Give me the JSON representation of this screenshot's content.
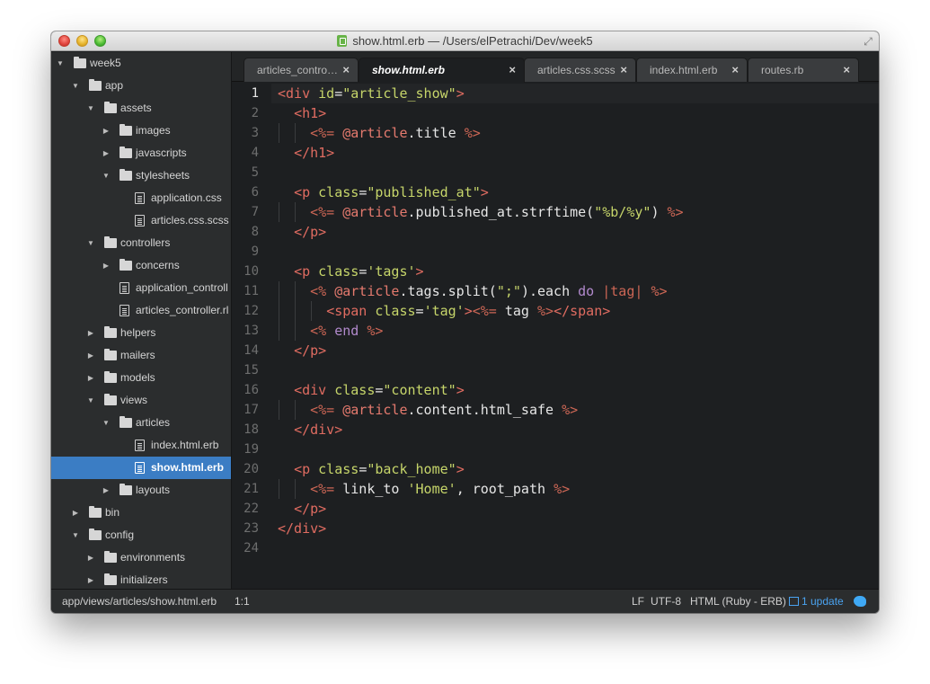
{
  "window": {
    "title": "show.html.erb — /Users/elPetrachi/Dev/week5"
  },
  "sidebar": {
    "items": [
      {
        "label": "week5",
        "type": "folder",
        "depth": 0,
        "expanded": true
      },
      {
        "label": "app",
        "type": "folder",
        "depth": 1,
        "expanded": true
      },
      {
        "label": "assets",
        "type": "folder",
        "depth": 2,
        "expanded": true
      },
      {
        "label": "images",
        "type": "folder",
        "depth": 3,
        "expanded": false
      },
      {
        "label": "javascripts",
        "type": "folder",
        "depth": 3,
        "expanded": false
      },
      {
        "label": "stylesheets",
        "type": "folder",
        "depth": 3,
        "expanded": true
      },
      {
        "label": "application.css",
        "type": "file",
        "depth": 4
      },
      {
        "label": "articles.css.scss",
        "type": "file",
        "depth": 4
      },
      {
        "label": "controllers",
        "type": "folder",
        "depth": 2,
        "expanded": true
      },
      {
        "label": "concerns",
        "type": "folder",
        "depth": 3,
        "expanded": false
      },
      {
        "label": "application_controll",
        "type": "file",
        "depth": 3
      },
      {
        "label": "articles_controller.rl",
        "type": "file",
        "depth": 3
      },
      {
        "label": "helpers",
        "type": "folder",
        "depth": 2,
        "expanded": false
      },
      {
        "label": "mailers",
        "type": "folder",
        "depth": 2,
        "expanded": false
      },
      {
        "label": "models",
        "type": "folder",
        "depth": 2,
        "expanded": false
      },
      {
        "label": "views",
        "type": "folder",
        "depth": 2,
        "expanded": true
      },
      {
        "label": "articles",
        "type": "folder",
        "depth": 3,
        "expanded": true
      },
      {
        "label": "index.html.erb",
        "type": "file",
        "depth": 4
      },
      {
        "label": "show.html.erb",
        "type": "file",
        "depth": 4,
        "selected": true
      },
      {
        "label": "layouts",
        "type": "folder",
        "depth": 3,
        "expanded": false
      },
      {
        "label": "bin",
        "type": "folder",
        "depth": 1,
        "expanded": false
      },
      {
        "label": "config",
        "type": "folder",
        "depth": 1,
        "expanded": true
      },
      {
        "label": "environments",
        "type": "folder",
        "depth": 2,
        "expanded": false
      },
      {
        "label": "initializers",
        "type": "folder",
        "depth": 2,
        "expanded": false
      }
    ]
  },
  "tabs": [
    {
      "label": "articles_contro…",
      "close": "×",
      "active": false
    },
    {
      "label": "show.html.erb",
      "close": "×",
      "active": true
    },
    {
      "label": "articles.css.scss",
      "close": "×",
      "active": false
    },
    {
      "label": "index.html.erb",
      "close": "×",
      "active": false
    },
    {
      "label": "routes.rb",
      "close": "×",
      "active": false
    }
  ],
  "editor": {
    "current_line": 1,
    "lines": [
      [
        [
          "tag",
          "<div "
        ],
        [
          "attr",
          "id"
        ],
        [
          "punct",
          "="
        ],
        [
          "str",
          "\"article_show\""
        ],
        [
          "tag",
          ">"
        ]
      ],
      [
        [
          "plain",
          "  "
        ],
        [
          "tag",
          "<h1>"
        ]
      ],
      [
        [
          "plain",
          "    "
        ],
        [
          "erb",
          "<%= "
        ],
        [
          "ivar",
          "@article"
        ],
        [
          "plain",
          ".title "
        ],
        [
          "erb",
          "%>"
        ]
      ],
      [
        [
          "plain",
          "  "
        ],
        [
          "tag",
          "</h1>"
        ]
      ],
      [],
      [
        [
          "plain",
          "  "
        ],
        [
          "tag",
          "<p "
        ],
        [
          "attr",
          "class"
        ],
        [
          "punct",
          "="
        ],
        [
          "str",
          "\"published_at\""
        ],
        [
          "tag",
          ">"
        ]
      ],
      [
        [
          "plain",
          "    "
        ],
        [
          "erb",
          "<%= "
        ],
        [
          "ivar",
          "@article"
        ],
        [
          "plain",
          ".published_at.strftime("
        ],
        [
          "str",
          "\"%b/%y\""
        ],
        [
          "plain",
          ") "
        ],
        [
          "erb",
          "%>"
        ]
      ],
      [
        [
          "plain",
          "  "
        ],
        [
          "tag",
          "</p>"
        ]
      ],
      [],
      [
        [
          "plain",
          "  "
        ],
        [
          "tag",
          "<p "
        ],
        [
          "attr",
          "class"
        ],
        [
          "punct",
          "="
        ],
        [
          "str",
          "'tags'"
        ],
        [
          "tag",
          ">"
        ]
      ],
      [
        [
          "plain",
          "    "
        ],
        [
          "erb",
          "<% "
        ],
        [
          "ivar",
          "@article"
        ],
        [
          "plain",
          ".tags.split("
        ],
        [
          "str",
          "\";\""
        ],
        [
          "plain",
          ").each "
        ],
        [
          "kw",
          "do"
        ],
        [
          "plain",
          " "
        ],
        [
          "erb",
          "|tag|"
        ],
        [
          "plain",
          " "
        ],
        [
          "erb",
          "%>"
        ]
      ],
      [
        [
          "plain",
          "      "
        ],
        [
          "tag",
          "<span "
        ],
        [
          "attr",
          "class"
        ],
        [
          "punct",
          "="
        ],
        [
          "str",
          "'tag'"
        ],
        [
          "tag",
          ">"
        ],
        [
          "erb",
          "<%= "
        ],
        [
          "plain",
          "tag "
        ],
        [
          "erb",
          "%>"
        ],
        [
          "tag",
          "</span>"
        ]
      ],
      [
        [
          "plain",
          "    "
        ],
        [
          "erb",
          "<% "
        ],
        [
          "kw",
          "end"
        ],
        [
          "plain",
          " "
        ],
        [
          "erb",
          "%>"
        ]
      ],
      [
        [
          "plain",
          "  "
        ],
        [
          "tag",
          "</p>"
        ]
      ],
      [],
      [
        [
          "plain",
          "  "
        ],
        [
          "tag",
          "<div "
        ],
        [
          "attr",
          "class"
        ],
        [
          "punct",
          "="
        ],
        [
          "str",
          "\"content\""
        ],
        [
          "tag",
          ">"
        ]
      ],
      [
        [
          "plain",
          "    "
        ],
        [
          "erb",
          "<%= "
        ],
        [
          "ivar",
          "@article"
        ],
        [
          "plain",
          ".content.html_safe "
        ],
        [
          "erb",
          "%>"
        ]
      ],
      [
        [
          "plain",
          "  "
        ],
        [
          "tag",
          "</div>"
        ]
      ],
      [],
      [
        [
          "plain",
          "  "
        ],
        [
          "tag",
          "<p "
        ],
        [
          "attr",
          "class"
        ],
        [
          "punct",
          "="
        ],
        [
          "str",
          "\"back_home\""
        ],
        [
          "tag",
          ">"
        ]
      ],
      [
        [
          "plain",
          "    "
        ],
        [
          "erb",
          "<%= "
        ],
        [
          "plain",
          "link_to "
        ],
        [
          "str",
          "'Home'"
        ],
        [
          "plain",
          ", root_path "
        ],
        [
          "erb",
          "%>"
        ]
      ],
      [
        [
          "plain",
          "  "
        ],
        [
          "tag",
          "</p>"
        ]
      ],
      [
        [
          "tag",
          "</div>"
        ]
      ],
      []
    ]
  },
  "status": {
    "path": "app/views/articles/show.html.erb",
    "position": "1:1",
    "line_endings": "LF",
    "encoding": "UTF-8",
    "syntax": "HTML (Ruby - ERB)",
    "update": "1 update"
  },
  "colors": {
    "background": "#1d1f21",
    "sidebar": "#2b2d2e",
    "selection": "#3b7dc4",
    "tag": "#e06c61",
    "attribute": "#c6d56a",
    "string": "#c6d56a",
    "erb": "#cc6655",
    "keyword": "#b28acd",
    "update_link": "#4aa3f0"
  }
}
